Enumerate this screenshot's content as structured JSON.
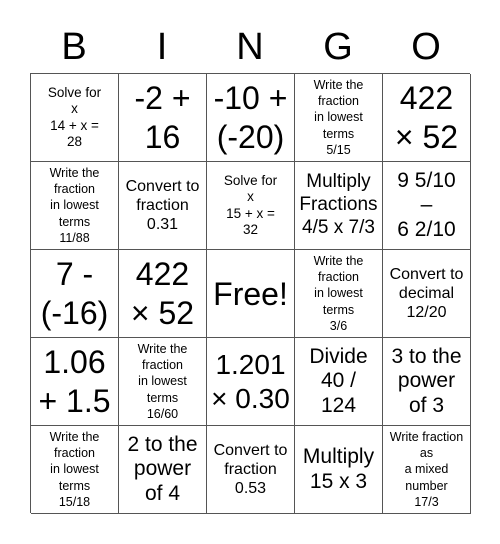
{
  "header": {
    "letters": [
      "B",
      "I",
      "N",
      "G",
      "O"
    ]
  },
  "cells": [
    {
      "text": "Solve for\nx\n14 + x =\n28",
      "size": "s-sm"
    },
    {
      "text": "-2 +\n16",
      "size": "s-xl"
    },
    {
      "text": "-10 +\n(-20)",
      "size": "s-xl"
    },
    {
      "text": "Write the\nfraction\nin lowest\nterms\n5/15",
      "size": "s-xs"
    },
    {
      "text": "422\n× 52",
      "size": "s-xl"
    },
    {
      "text": "Write the\nfraction\nin lowest\nterms\n11/88",
      "size": "s-xs"
    },
    {
      "text": "Convert to\nfraction\n0.31",
      "size": "s-md"
    },
    {
      "text": "Solve for\nx\n15 + x =\n32",
      "size": "s-sm"
    },
    {
      "text": "Multiply\nFractions\n4/5 x 7/3",
      "size": "s-lg-m"
    },
    {
      "text": "9 5/10\n–\n6 2/10",
      "size": "s-lg"
    },
    {
      "text": "7 -\n(-16)",
      "size": "s-xl"
    },
    {
      "text": "422\n× 52",
      "size": "s-xl"
    },
    {
      "text": "Free!",
      "size": "s-free"
    },
    {
      "text": "Write the\nfraction\nin lowest\nterms\n3/6",
      "size": "s-xs"
    },
    {
      "text": "Convert to\ndecimal\n12/20",
      "size": "s-md"
    },
    {
      "text": "1.06\n+ 1.5",
      "size": "s-xl"
    },
    {
      "text": "Write the\nfraction\nin lowest\nterms\n16/60",
      "size": "s-xs"
    },
    {
      "text": "1.201\n× 0.30",
      "size": "s-xl-s"
    },
    {
      "text": "Divide\n40 /\n124",
      "size": "s-lg"
    },
    {
      "text": "3 to the\npower\nof 3",
      "size": "s-lg"
    },
    {
      "text": "Write the\nfraction\nin lowest\nterms\n15/18",
      "size": "s-xs"
    },
    {
      "text": "2 to the\npower\nof 4",
      "size": "s-lg"
    },
    {
      "text": "Convert to\nfraction\n0.53",
      "size": "s-md"
    },
    {
      "text": "Multiply\n15 x 3",
      "size": "s-lg"
    },
    {
      "text": "Write fraction\nas\na mixed\nnumber\n17/3",
      "size": "s-xs"
    }
  ]
}
